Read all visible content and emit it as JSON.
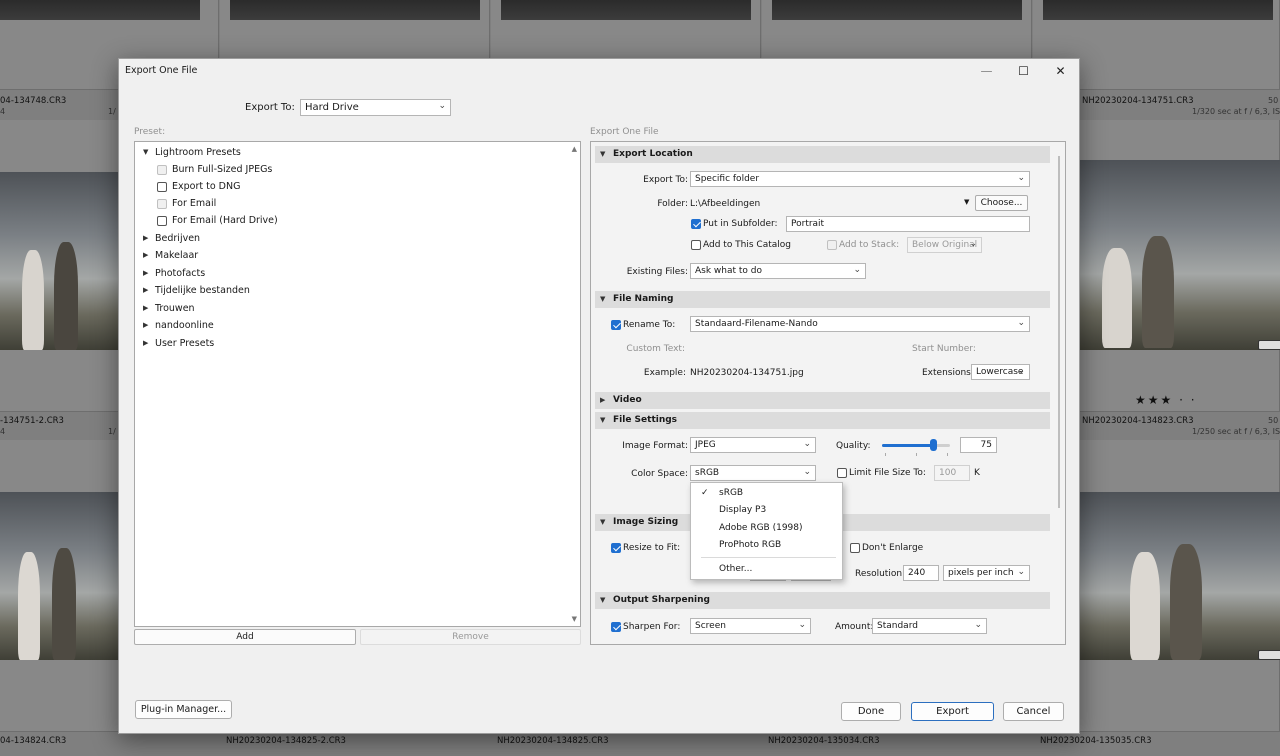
{
  "background": {
    "top_row_filenames": [],
    "filenames": {
      "r1a": "04-134748.CR3",
      "r1b": "NH20230204-134751.CR3",
      "r2a": "-134751-2.CR3",
      "r2b": "NH20230204-134823.CR3",
      "r3a": "04-134824.CR3",
      "r3b": "NH20230204-134825-2.CR3",
      "r3c": "NH20230204-134825.CR3",
      "r3d": "NH20230204-135034.CR3",
      "r3e": "NH20230204-135035.CR3"
    },
    "meta": {
      "r1_small_a": "4",
      "r1_small_b": "1/",
      "r1_num": "50",
      "r1_exif": "1/320 sec at f / 6,3, ISO",
      "r2_small_a": "4",
      "r2_small_b": "1/",
      "r2_num": "50",
      "r2_exif": "1/250 sec at f / 6,3, ISO"
    },
    "stars": "★★★ · ·"
  },
  "dialog": {
    "title": "Export One File",
    "minimize": "—",
    "maximize": "☐",
    "close": "✕",
    "export_to_label": "Export To:",
    "export_to_value": "Hard Drive",
    "preset_label": "Preset:",
    "right_header": "Export One File",
    "presets": {
      "lightroom": "Lightroom Presets",
      "items": [
        "Burn Full-Sized JPEGs",
        "Export to DNG",
        "For Email",
        "For Email (Hard Drive)"
      ],
      "folders": [
        "Bedrijven",
        "Makelaar",
        "Photofacts",
        "Tijdelijke bestanden",
        "Trouwen",
        "nandoonline",
        "User Presets"
      ]
    },
    "add_button": "Add",
    "remove_button": "Remove",
    "plugin_manager": "Plug-in Manager...",
    "done": "Done",
    "export": "Export",
    "cancel": "Cancel"
  },
  "export_location": {
    "header": "Export Location",
    "export_to_label": "Export To:",
    "export_to_value": "Specific folder",
    "folder_label": "Folder:",
    "folder_value": "L:\\Afbeeldingen",
    "choose": "Choose...",
    "subfolder_label": "Put in Subfolder:",
    "subfolder_value": "Portrait",
    "add_catalog": "Add to This Catalog",
    "add_stack": "Add to Stack:",
    "stack_value": "Below Original",
    "existing_label": "Existing Files:",
    "existing_value": "Ask what to do"
  },
  "file_naming": {
    "header": "File Naming",
    "rename_label": "Rename To:",
    "rename_value": "Standaard-Filename-Nando",
    "custom_text": "Custom Text:",
    "start_number": "Start Number:",
    "example_label": "Example:",
    "example_value": "NH20230204-134751.jpg",
    "extensions_label": "Extensions:",
    "extensions_value": "Lowercase"
  },
  "video": {
    "header": "Video"
  },
  "file_settings": {
    "header": "File Settings",
    "format_label": "Image Format:",
    "format_value": "JPEG",
    "quality_label": "Quality:",
    "quality_value": "75",
    "quality_fraction": 0.75,
    "color_space_label": "Color Space:",
    "color_space_value": "sRGB",
    "limit_label": "Limit File Size To:",
    "limit_value": "100",
    "limit_unit": "K"
  },
  "color_space_menu": {
    "check": "✓",
    "options": [
      "sRGB",
      "Display P3",
      "Adobe RGB (1998)",
      "ProPhoto RGB"
    ],
    "other": "Other..."
  },
  "image_sizing": {
    "header": "Image Sizing",
    "resize_label": "Resize to Fit:",
    "dont_enlarge": "Don't Enlarge",
    "resolution_label": "Resolution:",
    "resolution_value": "240",
    "resolution_unit": "pixels per inch"
  },
  "output_sharpening": {
    "header": "Output Sharpening",
    "sharpen_label": "Sharpen For:",
    "sharpen_value": "Screen",
    "amount_label": "Amount:",
    "amount_value": "Standard"
  },
  "icons": {
    "dropdown": "⌄",
    "expanded": "▼",
    "collapsed": "▶",
    "scroll_up": "▲",
    "scroll_down": "▼"
  },
  "colors": {
    "accent": "#1f6fd0",
    "primary_border": "#2c6fbf"
  }
}
